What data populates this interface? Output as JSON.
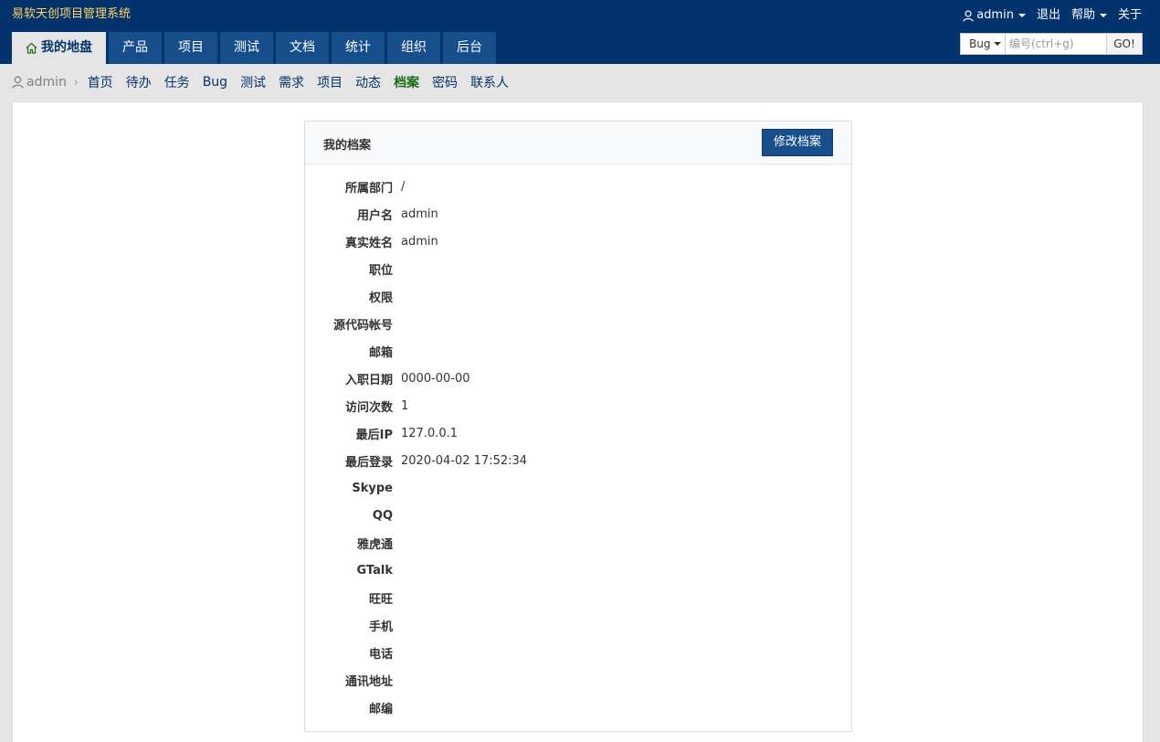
{
  "header": {
    "app_title": "易软天创项目管理系统",
    "user": "admin",
    "logout": "退出",
    "help": "帮助",
    "about": "关于"
  },
  "main_nav": [
    {
      "label": "我的地盘",
      "active": true
    },
    {
      "label": "产品"
    },
    {
      "label": "项目"
    },
    {
      "label": "测试"
    },
    {
      "label": "文档"
    },
    {
      "label": "统计"
    },
    {
      "label": "组织"
    },
    {
      "label": "后台"
    }
  ],
  "search": {
    "type_value": "Bug",
    "placeholder": "编号(ctrl+g)",
    "go_label": "GO!"
  },
  "sub_nav": {
    "crumb": "admin",
    "links": [
      "首页",
      "待办",
      "任务",
      "Bug",
      "测试",
      "需求",
      "项目",
      "动态",
      "档案",
      "密码",
      "联系人"
    ],
    "active_index": 8
  },
  "panel": {
    "title": "我的档案",
    "edit_label": "修改档案",
    "rows": [
      {
        "label": "所属部门",
        "value": "/"
      },
      {
        "label": "用户名",
        "value": "admin"
      },
      {
        "label": "真实姓名",
        "value": "admin"
      },
      {
        "label": "职位",
        "value": ""
      },
      {
        "label": "权限",
        "value": ""
      },
      {
        "label": "源代码帐号",
        "value": ""
      },
      {
        "label": "邮箱",
        "value": ""
      },
      {
        "label": "入职日期",
        "value": "0000-00-00"
      },
      {
        "label": "访问次数",
        "value": "1"
      },
      {
        "label": "最后IP",
        "value": "127.0.0.1"
      },
      {
        "label": "最后登录",
        "value": "2020-04-02 17:52:34"
      },
      {
        "label": "Skype",
        "value": ""
      },
      {
        "label": "QQ",
        "value": ""
      },
      {
        "label": "雅虎通",
        "value": ""
      },
      {
        "label": "GTalk",
        "value": ""
      },
      {
        "label": "旺旺",
        "value": ""
      },
      {
        "label": "手机",
        "value": ""
      },
      {
        "label": "电话",
        "value": ""
      },
      {
        "label": "通讯地址",
        "value": ""
      },
      {
        "label": "邮编",
        "value": ""
      }
    ]
  },
  "colors": {
    "header_bg": "#03336c",
    "tab_bg": "#174f8c",
    "title_color": "#ffd563",
    "active_link": "#1a6b1a"
  },
  "icons": {
    "home": "home-icon",
    "user": "user-icon"
  }
}
